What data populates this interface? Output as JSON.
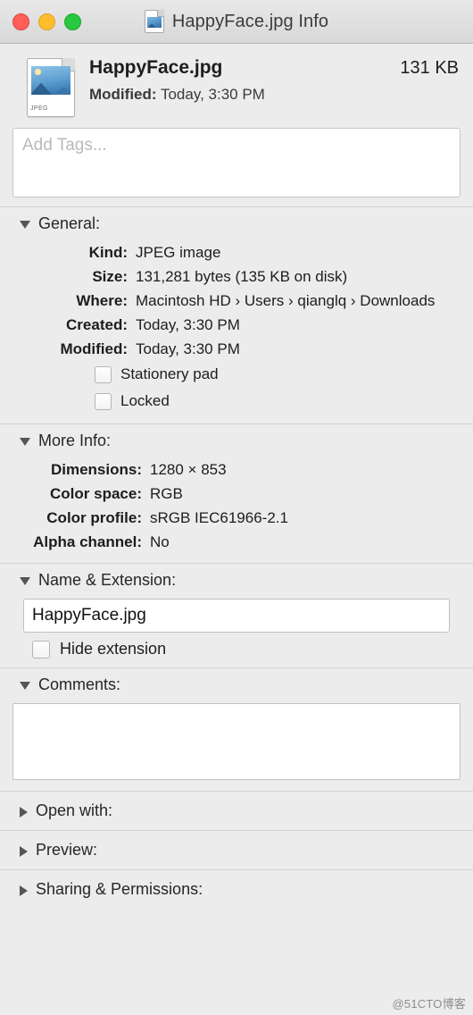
{
  "window": {
    "title": "HappyFace.jpg Info",
    "title_icon": "jpeg-document-icon",
    "traffic_lights": {
      "close": "close-button",
      "minimize": "minimize-button",
      "zoom": "zoom-button"
    }
  },
  "header": {
    "icon_label": "JPEG",
    "file_name": "HappyFace.jpg",
    "modified_label": "Modified:",
    "modified_value": "Today, 3:30 PM",
    "file_size": "131 KB"
  },
  "tags": {
    "placeholder": "Add Tags..."
  },
  "general": {
    "title": "General:",
    "expanded": true,
    "rows": [
      {
        "key": "Kind:",
        "value": "JPEG image"
      },
      {
        "key": "Size:",
        "value": "131,281 bytes (135 KB on disk)"
      },
      {
        "key": "Where:",
        "value": "Macintosh HD › Users › qianglq › Downloads"
      },
      {
        "key": "Created:",
        "value": "Today, 3:30 PM"
      },
      {
        "key": "Modified:",
        "value": "Today, 3:30 PM"
      }
    ],
    "checkboxes": [
      {
        "label": "Stationery pad",
        "checked": false
      },
      {
        "label": "Locked",
        "checked": false
      }
    ]
  },
  "more_info": {
    "title": "More Info:",
    "expanded": true,
    "rows": [
      {
        "key": "Dimensions:",
        "value": "1280 × 853"
      },
      {
        "key": "Color space:",
        "value": "RGB"
      },
      {
        "key": "Color profile:",
        "value": "sRGB IEC61966-2.1"
      },
      {
        "key": "Alpha channel:",
        "value": "No"
      }
    ]
  },
  "name_extension": {
    "title": "Name & Extension:",
    "expanded": true,
    "value": "HappyFace.jpg",
    "hide_extension_label": "Hide extension",
    "hide_extension_checked": false
  },
  "comments": {
    "title": "Comments:",
    "expanded": true,
    "value": ""
  },
  "collapsed_sections": [
    {
      "title": "Open with:",
      "expanded": false
    },
    {
      "title": "Preview:",
      "expanded": false
    },
    {
      "title": "Sharing & Permissions:",
      "expanded": false
    }
  ],
  "watermark": "@51CTO博客"
}
